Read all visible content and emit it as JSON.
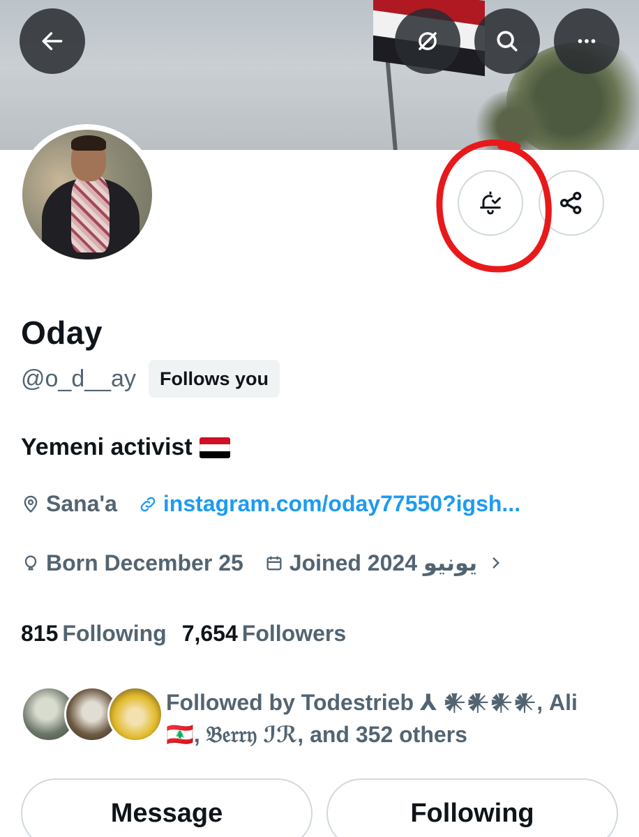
{
  "profile": {
    "name": "Oday",
    "handle": "@o_d__ay",
    "follows_you": "Follows you",
    "bio": "Yemeni activist",
    "location": "Sana'a",
    "website": "instagram.com/oday77550?igsh...",
    "birthday": "Born December 25",
    "joined": "Joined 2024 يونيو",
    "following_count": "815",
    "following_label": "Following",
    "followers_count": "7,654",
    "followers_label": "Followers",
    "followed_by": "Followed by Todestrieb ⅄ 𒀭𒀭𒀭𒀭, Ali",
    "followed_by_2": "🇱🇧, 𝔅𝔢𝔯𝔯𝔶 ℐℛ, and 352 others"
  },
  "buttons": {
    "message": "Message",
    "following": "Following"
  },
  "icons": {
    "back": "arrow-left-icon",
    "grok": "grok-icon",
    "search": "search-icon",
    "more": "more-icon",
    "notifications": "bell-check-icon",
    "share": "share-icon"
  },
  "colors": {
    "accent": "#1d9bf0",
    "secondary_text": "#536471",
    "annotation": "#e8191b"
  }
}
